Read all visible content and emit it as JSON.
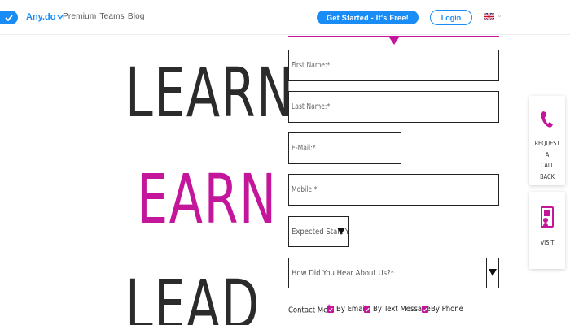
{
  "header": {
    "brand": "Any.do",
    "nav_links": [
      "Premium",
      "Teams",
      "Blog"
    ],
    "cta_label": "Get Started - It's Free!",
    "login_label": "Login",
    "language_flag": "uk-flag-icon"
  },
  "headline": {
    "line1": "LEARN",
    "line2": "EARN",
    "line3": "LEAD"
  },
  "form": {
    "first_name_placeholder": "First Name:*",
    "last_name_placeholder": "Last Name:*",
    "email_placeholder": "E-Mail:*",
    "mobile_placeholder": "Mobile:*",
    "start_select_value": "Expected Start Y",
    "hear_select_value": "How Did You Hear About Us?*",
    "contact_label": "Contact Me",
    "contact_required": "*",
    "options": [
      {
        "label": "By Email",
        "checked": true
      },
      {
        "label": "By Text Message",
        "checked": true
      },
      {
        "label": "By Phone",
        "checked": true
      }
    ]
  },
  "side_cards": {
    "callback_line1": "REQUEST A",
    "callback_line2": "CALL BACK",
    "visit_label": "VISIT"
  },
  "colors": {
    "brand_blue": "#1a8cf5",
    "accent_magenta": "#c4169a",
    "text_dark": "#2b2b2b"
  }
}
